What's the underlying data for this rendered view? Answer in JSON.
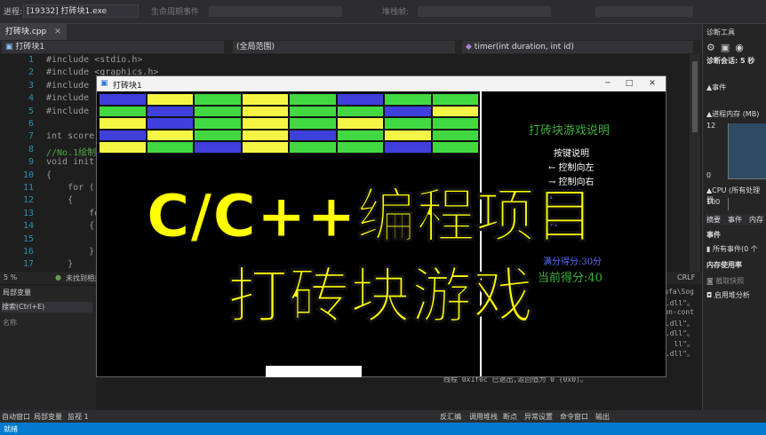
{
  "toolbar": {
    "process_label": "进程:",
    "process_value": "[19332] 打砖块1.exe",
    "lifecycle_label": "生命周期事件",
    "thread_label": "线程:",
    "stack_label": "堆栈帧:"
  },
  "editor": {
    "file_tab": "打砖块.cpp",
    "project_dropdown": "打砖块1",
    "scope_dropdown": "(全局范围)",
    "function_dropdown": "timer(int duration, int id)",
    "line_numbers": [
      "1",
      "2",
      "3",
      "4",
      "5",
      "6",
      "7",
      "8",
      "9",
      "10",
      "11",
      "12",
      "13",
      "14",
      "15",
      "16",
      "17"
    ],
    "code_lines": [
      "#include <stdio.h>",
      "#include <graphics.h>",
      "#include",
      "#include",
      "#include",
      "",
      "int score",
      "//No.1绘制",
      "void init",
      "{",
      "    for (",
      "    {",
      "        fo",
      "        {",
      "",
      "        }",
      "    }"
    ],
    "zoom": "5 %",
    "status_text": "未找到相关问题",
    "encoding": "CRLF"
  },
  "locals_panel": {
    "title": "局部变量",
    "search": "搜索(Ctrl+E)",
    "column": "名称"
  },
  "output_panel": {
    "lines": [
      "Temporary\\sogoushurufa\\Sog",
      "2.dll\"。",
      "rosoft.windows.common-cont",
      ".dll\"。",
      ".dll\"。",
      "ll\"。",
      "ping.dll\"。",
      "线程 0x5080 已退出,返回值为 0 (0x0)。",
      "线程 0x1f0c 已退出,返回值为 0 (0x0)。"
    ]
  },
  "bottom_tabs": [
    "自动窗口",
    "局部变量",
    "监视 1"
  ],
  "bottom_tabs_right": [
    "反汇编",
    "调用堆栈",
    "断点",
    "异常设置",
    "命令窗口",
    "输出"
  ],
  "footer_text": "就绪",
  "diagnostics": {
    "title": "诊断工具",
    "session": "诊断会话: 5 秒",
    "events": "▲事件",
    "memory": "▲进程内存 (MB)",
    "mem_max": "12",
    "mem_min": "0",
    "cpu": "▲CPU (所有处理器",
    "cpu_max": "100",
    "tabs": [
      "摘要",
      "事件",
      "内存"
    ],
    "events_header": "事件",
    "all_events": "所有事件(0 个",
    "mem_usage": "内存使用率",
    "snapshot": "截取快照",
    "heap": "启用堆分析"
  },
  "game": {
    "title": "打砖块1",
    "info_title": "打砖块游戏说明",
    "keys_title": "按键说明",
    "key_left": "← 控制向左",
    "key_right": "→ 控制向右",
    "partial_1": "1",
    "partial_2": "剩",
    "total_score": "满分得分:30分",
    "current_score": "当前得分:40",
    "win_minimize": "─",
    "win_maximize": "□",
    "win_close": "✕",
    "colors": {
      "blue": "#3f3fdc",
      "yellow": "#f5f545",
      "green": "#41d841",
      "bg": "#000000"
    },
    "bricks": [
      [
        "blue",
        "yellow",
        "green",
        "yellow",
        "green",
        "blue",
        "green",
        "green"
      ],
      [
        "green",
        "blue",
        "green",
        "yellow",
        "green",
        "green",
        "blue",
        "yellow"
      ],
      [
        "yellow",
        "blue",
        "green",
        "yellow",
        "green",
        "yellow",
        "green",
        "green"
      ],
      [
        "blue",
        "yellow",
        "green",
        "yellow",
        "blue",
        "green",
        "yellow",
        "green"
      ],
      [
        "yellow",
        "green",
        "blue",
        "yellow",
        "green",
        "green",
        "blue",
        "green"
      ]
    ]
  },
  "overlay": {
    "line1": "C/C++编程项目",
    "line2": "打砖块游戏",
    "color": "#ffff00"
  }
}
